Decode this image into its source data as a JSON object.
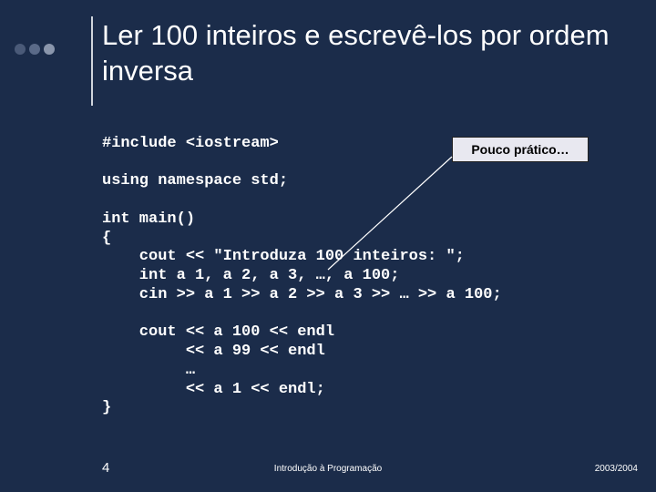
{
  "title": "Ler 100 inteiros e escrevê-los por ordem inversa",
  "dots": [
    "#4a5a78",
    "#5a6a88",
    "#8a96ac"
  ],
  "callout": "Pouco prático…",
  "code": {
    "l1": "#include <iostream>",
    "l2": "",
    "l3": "using namespace std;",
    "l4": "",
    "l5": "int main()",
    "l6": "{",
    "l7": "    cout << \"Introduza 100 inteiros: \";",
    "l8": "    int a 1, a 2, a 3, …, a 100;",
    "l9": "    cin >> a 1 >> a 2 >> a 3 >> … >> a 100;",
    "l10": "",
    "l11": "    cout << a 100 << endl",
    "l12": "         << a 99 << endl",
    "l13": "         …",
    "l14": "         << a 1 << endl;",
    "l15": "}"
  },
  "footer": {
    "slide_number": "4",
    "center": "Introdução à Programação",
    "right": "2003/2004"
  }
}
